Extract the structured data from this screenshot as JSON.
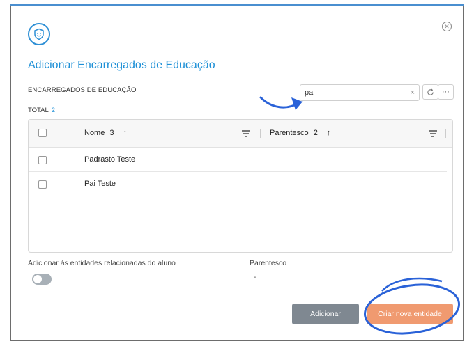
{
  "dialog": {
    "title": "Adicionar Encarregados de Educação",
    "close_symbol": "✕",
    "header_icon": "shield-face-icon"
  },
  "list": {
    "section_label": "ENCARREGADOS DE EDUCAÇÃO",
    "total_label": "TOTAL",
    "total_count": "2"
  },
  "search": {
    "value": "pa",
    "clear_symbol": "×"
  },
  "toolbar": {
    "refresh_icon": "refresh-icon",
    "more_symbol": "···"
  },
  "table": {
    "columns": [
      {
        "label": "Nome",
        "count": "3",
        "sort": "↑"
      },
      {
        "label": "Parentesco",
        "count": "2",
        "sort": "↑"
      }
    ],
    "rows": [
      {
        "nome": "Padrasto Teste",
        "parentesco": ""
      },
      {
        "nome": "Pai Teste",
        "parentesco": ""
      }
    ]
  },
  "options": {
    "toggle_label": "Adicionar às entidades relacionadas do aluno",
    "toggle_on": false,
    "parentesco_label": "Parentesco",
    "parentesco_value": "-"
  },
  "footer": {
    "add_label": "Adicionar",
    "create_label": "Criar nova entidade"
  },
  "colors": {
    "accent": "#1c8fd6",
    "annotation": "#2a62d8",
    "create_button": "#f09a70",
    "add_button": "#7f8891"
  }
}
